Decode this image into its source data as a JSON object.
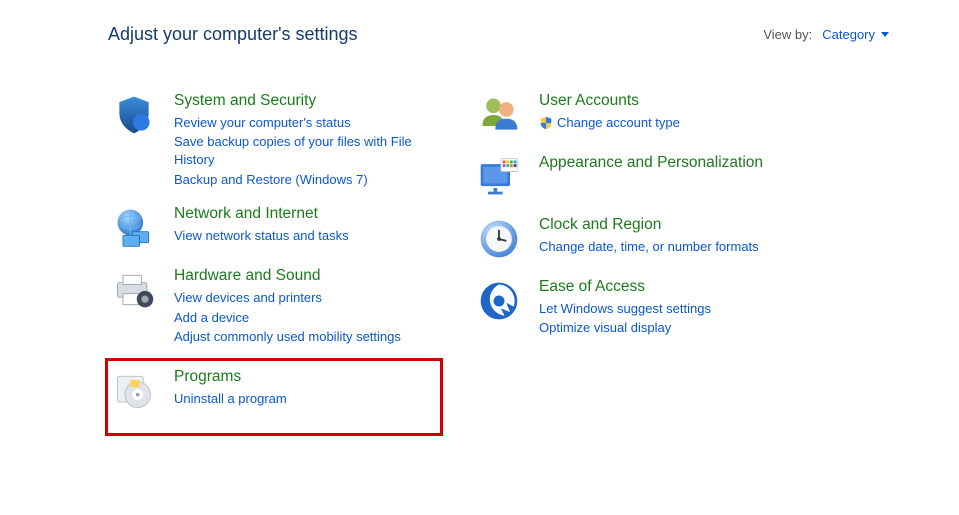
{
  "header": {
    "title": "Adjust your computer's settings",
    "viewby_label": "View by:",
    "viewby_value": "Category"
  },
  "left": [
    {
      "icon": "shield-icon",
      "title": "System and Security",
      "links": [
        {
          "label": "Review your computer's status",
          "shield": false
        },
        {
          "label": "Save backup copies of your files with File History",
          "shield": false
        },
        {
          "label": "Backup and Restore (Windows 7)",
          "shield": false
        }
      ]
    },
    {
      "icon": "globe-network-icon",
      "title": "Network and Internet",
      "links": [
        {
          "label": "View network status and tasks",
          "shield": false
        }
      ]
    },
    {
      "icon": "printer-hardware-icon",
      "title": "Hardware and Sound",
      "links": [
        {
          "label": "View devices and printers",
          "shield": false
        },
        {
          "label": "Add a device",
          "shield": false
        },
        {
          "label": "Adjust commonly used mobility settings",
          "shield": false
        }
      ]
    },
    {
      "icon": "programs-icon",
      "title": "Programs",
      "highlight": true,
      "links": [
        {
          "label": "Uninstall a program",
          "shield": false
        }
      ]
    }
  ],
  "right": [
    {
      "icon": "users-icon",
      "title": "User Accounts",
      "links": [
        {
          "label": "Change account type",
          "shield": true
        }
      ]
    },
    {
      "icon": "appearance-icon",
      "title": "Appearance and Personalization",
      "links": []
    },
    {
      "icon": "clock-icon",
      "title": "Clock and Region",
      "links": [
        {
          "label": "Change date, time, or number formats",
          "shield": false
        }
      ]
    },
    {
      "icon": "ease-access-icon",
      "title": "Ease of Access",
      "links": [
        {
          "label": "Let Windows suggest settings",
          "shield": false
        },
        {
          "label": "Optimize visual display",
          "shield": false
        }
      ]
    }
  ]
}
